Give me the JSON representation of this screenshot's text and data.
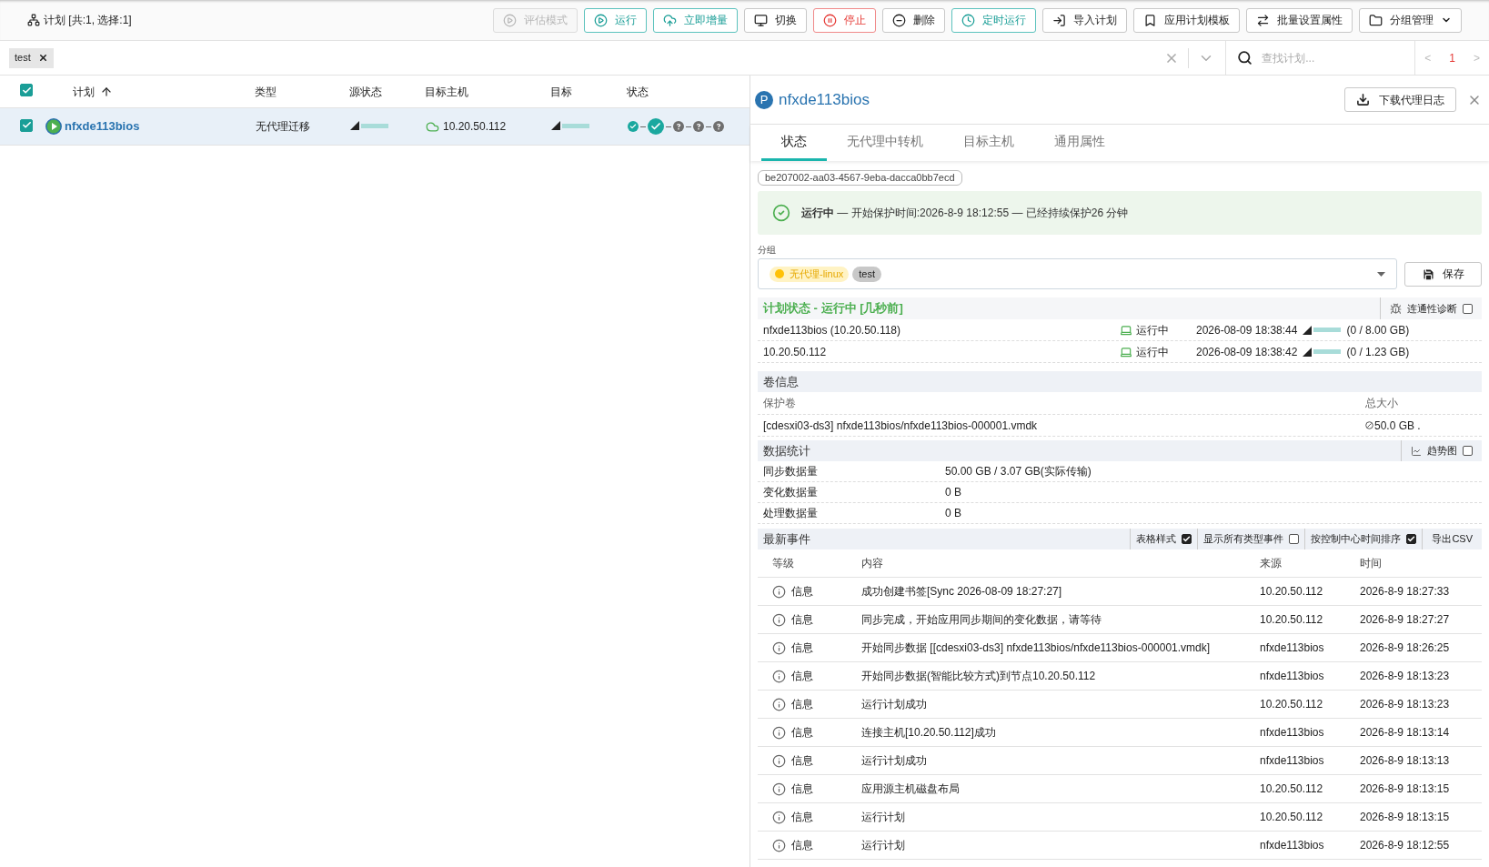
{
  "toolbar": {
    "title": "计划 [共:1, 选择:1]",
    "buttons": [
      {
        "label": "评估模式",
        "kind": "disabled"
      },
      {
        "label": "运行",
        "kind": "primary"
      },
      {
        "label": "立即增量",
        "kind": "primary"
      },
      {
        "label": "切换",
        "kind": "default"
      },
      {
        "label": "停止",
        "kind": "danger"
      },
      {
        "label": "删除",
        "kind": "default"
      },
      {
        "label": "定时运行",
        "kind": "primary"
      },
      {
        "label": "导入计划",
        "kind": "default"
      },
      {
        "label": "应用计划模板",
        "kind": "default"
      },
      {
        "label": "批量设置属性",
        "kind": "default"
      },
      {
        "label": "分组管理",
        "kind": "menu"
      }
    ]
  },
  "filter": {
    "tags": [
      "test"
    ],
    "search_placeholder": "查找计划...",
    "prev": "<",
    "page": "1",
    "next": ">"
  },
  "table": {
    "all_checked": true,
    "columns": [
      "计划",
      "类型",
      "源状态",
      "目标主机",
      "目标",
      "状态"
    ],
    "rows": [
      {
        "checked": true,
        "selected": true,
        "name": "nfxde113bios",
        "type": "无代理迁移",
        "source": {
          "level": 0
        },
        "target_host": "10.20.50.112",
        "target": {
          "level": 0
        },
        "steps": [
          {
            "kind": "done",
            "selected": false
          },
          {
            "kind": "done",
            "selected": true
          },
          {
            "kind": "unknown",
            "selected": false
          },
          {
            "kind": "unknown",
            "selected": false
          },
          {
            "kind": "unknown",
            "selected": false
          }
        ]
      }
    ]
  },
  "detail": {
    "badge": "P",
    "title": "nfxde113bios",
    "download": "下载代理日志",
    "tabs": [
      {
        "label": "状态",
        "selected": true
      },
      {
        "label": "无代理中转机",
        "selected": false
      },
      {
        "label": "目标主机",
        "selected": false
      },
      {
        "label": "通用属性",
        "selected": false
      }
    ],
    "id": "be207002-aa03-4567-9eba-dacca0bb7ecd",
    "banner": "**运行中** — 开始保护时间:2026-8-9 18:12:55 — 已经持续保护26 分钟",
    "group": {
      "label": "分组",
      "chips": [
        {
          "label": "无代理-linux",
          "kind": "dot",
          "color": "#ffc107"
        },
        {
          "label": "test",
          "kind": "plain",
          "color": "#c8c8c8"
        }
      ],
      "save": "保存"
    },
    "plan_status": {
      "title": "计划状态 - 运行中 [几秒前]",
      "diagnose": "连通性诊断",
      "diagnose_checked": false,
      "hosts": [
        {
          "name": "nfxde113bios (10.20.50.118)",
          "status": "运行中",
          "time": "2026-08-09 18:38:44",
          "level": 0,
          "size": "(0 / 8.00 GB)"
        },
        {
          "name": "10.20.50.112",
          "status": "运行中",
          "time": "2026-08-09 18:38:42",
          "level": 0,
          "size": "(0 / 1.23 GB)"
        }
      ]
    },
    "volumes": {
      "title": "卷信息",
      "columns": [
        "保护卷",
        "总大小"
      ],
      "rows": [
        {
          "volume": "[cdesxi03-ds3] nfxde113bios/nfxde113bios-000001.vmdk",
          "size": "50.0 GB ."
        }
      ]
    },
    "stats": {
      "title": "数据统计",
      "trend": "趋势图",
      "trend_checked": false,
      "rows": [
        {
          "label": "同步数据量",
          "value": "50.00 GB / 3.07 GB(实际传输)"
        },
        {
          "label": "变化数据量",
          "value": "0 B"
        },
        {
          "label": "处理数据量",
          "value": "0 B"
        }
      ]
    },
    "events": {
      "title": "最新事件",
      "options": [
        {
          "label": "表格样式",
          "checked": true
        },
        {
          "label": "显示所有类型事件",
          "checked": false
        },
        {
          "label": "按控制中心时间排序",
          "checked": true
        }
      ],
      "export": "导出CSV",
      "columns": [
        "等级",
        "内容",
        "来源",
        "时间"
      ],
      "rows": [
        {
          "level": "信息",
          "content": "成功创建书签[Sync 2026-08-09 18:27:27]",
          "source": "10.20.50.112",
          "time": "2026-8-9 18:27:33"
        },
        {
          "level": "信息",
          "content": "同步完成，开始应用同步期间的变化数据，请等待",
          "source": "10.20.50.112",
          "time": "2026-8-9 18:27:27"
        },
        {
          "level": "信息",
          "content": "开始同步数据 [[cdesxi03-ds3] nfxde113bios/nfxde113bios-000001.vmdk]",
          "source": "nfxde113bios",
          "time": "2026-8-9 18:26:25"
        },
        {
          "level": "信息",
          "content": "开始同步数据(智能比较方式)到节点10.20.50.112",
          "source": "nfxde113bios",
          "time": "2026-8-9 18:13:23"
        },
        {
          "level": "信息",
          "content": "运行计划成功",
          "source": "10.20.50.112",
          "time": "2026-8-9 18:13:23"
        },
        {
          "level": "信息",
          "content": "连接主机[10.20.50.112]成功",
          "source": "nfxde113bios",
          "time": "2026-8-9 18:13:14"
        },
        {
          "level": "信息",
          "content": "运行计划成功",
          "source": "nfxde113bios",
          "time": "2026-8-9 18:13:13"
        },
        {
          "level": "信息",
          "content": "应用源主机磁盘布局",
          "source": "10.20.50.112",
          "time": "2026-8-9 18:13:15"
        },
        {
          "level": "信息",
          "content": "运行计划",
          "source": "10.20.50.112",
          "time": "2026-8-9 18:13:15"
        },
        {
          "level": "信息",
          "content": "运行计划",
          "source": "nfxde113bios",
          "time": "2026-8-9 18:12:55"
        }
      ]
    }
  }
}
